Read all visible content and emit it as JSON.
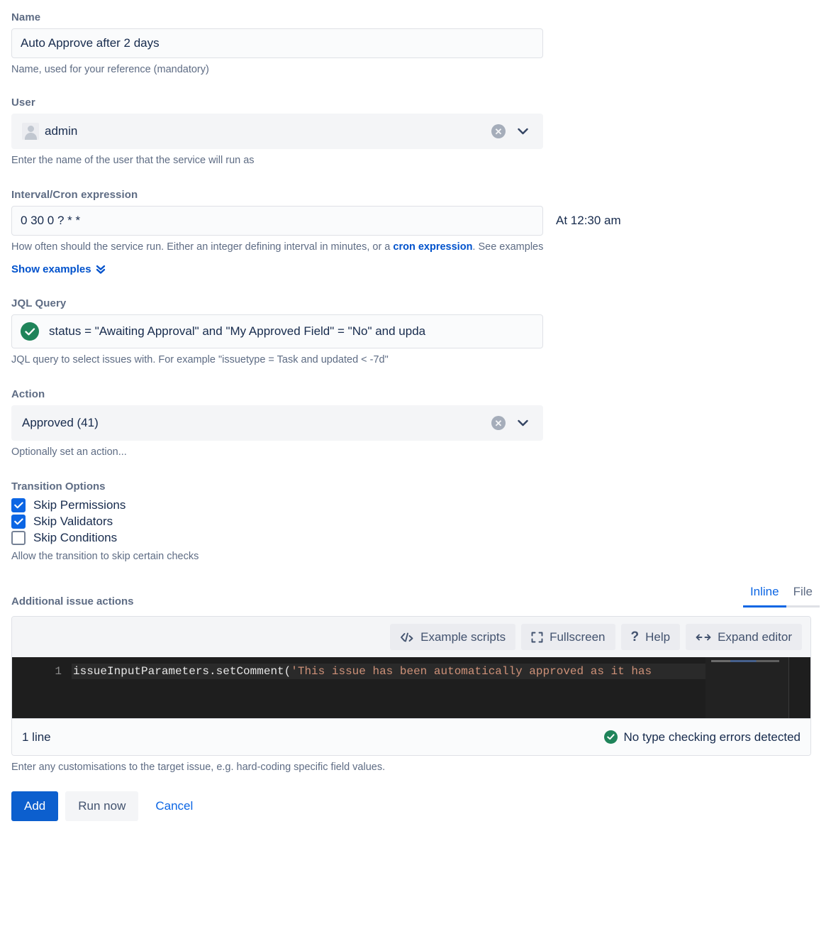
{
  "name_field": {
    "label": "Name",
    "value": "Auto Approve after 2 days",
    "help": "Name, used for your reference (mandatory)"
  },
  "user_field": {
    "label": "User",
    "value": "admin",
    "help": "Enter the name of the user that the service will run as",
    "avatar_icon": "user-avatar-icon",
    "clear_icon": "clear-icon",
    "chevron_icon": "chevron-down-icon"
  },
  "cron_field": {
    "label": "Interval/Cron expression",
    "value": "0 30 0 ? * *",
    "description": "At 12:30 am",
    "help_prefix": "How often should the service run. Either an integer defining interval in minutes, or a ",
    "help_link": "cron expression",
    "help_suffix": ". See examples",
    "show_examples_label": "Show examples",
    "double_chevron_icon": "double-chevron-down-icon"
  },
  "jql_field": {
    "label": "JQL Query",
    "value": "status = \"Awaiting Approval\" and \"My Approved Field\" = \"No\" and upda",
    "valid_icon": "check-circle-icon",
    "help": "JQL query to select issues with. For example \"issuetype = Task and updated < -7d\""
  },
  "action_field": {
    "label": "Action",
    "value": "Approved (41)",
    "help": "Optionally set an action...",
    "clear_icon": "clear-icon",
    "chevron_icon": "chevron-down-icon"
  },
  "transition_options": {
    "label": "Transition Options",
    "items": [
      {
        "label": "Skip Permissions",
        "checked": true
      },
      {
        "label": "Skip Validators",
        "checked": true
      },
      {
        "label": "Skip Conditions",
        "checked": false
      }
    ],
    "help": "Allow the transition to skip certain checks"
  },
  "additional_actions": {
    "label": "Additional issue actions",
    "tabs": [
      {
        "label": "Inline",
        "active": true
      },
      {
        "label": "File",
        "active": false
      }
    ],
    "toolbar": [
      {
        "label": "Example scripts",
        "icon": "code-tags-icon"
      },
      {
        "label": "Fullscreen",
        "icon": "fullscreen-icon"
      },
      {
        "label": "Help",
        "icon": "question-mark-icon"
      },
      {
        "label": "Expand editor",
        "icon": "arrows-horizontal-icon"
      }
    ],
    "editor": {
      "line_number": "1",
      "code_plain": "issueInputParameters.setComment(",
      "code_string": "'This issue has been automatically approved as it has",
      "line_count": "1 line",
      "status": "No type checking errors detected",
      "status_icon": "check-circle-icon"
    },
    "help": "Enter any customisations to the target issue, e.g. hard-coding specific field values."
  },
  "buttons": {
    "add": "Add",
    "run_now": "Run now",
    "cancel": "Cancel"
  },
  "colors": {
    "accent": "#0C66E4",
    "primary_button": "#0C5FCE",
    "success": "#1F845A",
    "label": "#5E6C84",
    "editor_bg": "#1E1E1E",
    "code_string": "#CE9178"
  }
}
